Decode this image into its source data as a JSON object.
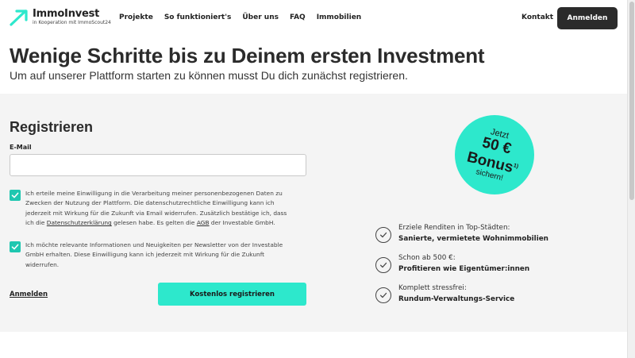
{
  "header": {
    "logo_name": "ImmoInvest",
    "logo_sub": "in Kooperation mit ImmoScout24",
    "nav": [
      "Projekte",
      "So funktioniert's",
      "Über uns",
      "FAQ",
      "Immobilien"
    ],
    "kontakt": "Kontakt",
    "anmelden": "Anmelden"
  },
  "hero": {
    "title": "Wenige Schritte bis zu Deinem ersten Investment",
    "subtitle": "Um auf unserer Plattform starten zu können musst Du dich zunächst registrieren."
  },
  "form": {
    "title": "Registrieren",
    "email_label": "E-Mail",
    "email_value": "",
    "email_placeholder": "",
    "consent1_a": "Ich erteile meine Einwilligung in die Verarbeitung meiner personenbezogenen Daten zu Zwecken der Nutzung der Plattform. Die datenschutzrechtliche Einwilligung kann ich jederzeit mit Wirkung für die Zukunft via Email widerrufen. Zusätzlich bestätige ich, dass ich die ",
    "consent1_link1": "Datenschutzerklärung",
    "consent1_b": " gelesen habe. Es gelten die ",
    "consent1_link2": "AGB",
    "consent1_c": " der Investable GmbH.",
    "consent2": "Ich möchte relevante Informationen und Neuigkeiten per Newsletter von der Investable GmbH erhalten. Diese Einwilligung kann ich jederzeit mit Wirkung für die Zukunft widerrufen.",
    "login_link": "Anmelden",
    "register_button": "Kostenlos registrieren"
  },
  "bonus": {
    "jetzt": "Jetzt",
    "amount": "50 €",
    "word": "Bonus",
    "sup": "1)",
    "sichern": "sichern!"
  },
  "benefits": [
    {
      "line1": "Erziele Renditen in Top-Städten:",
      "line2": "Sanierte, vermietete Wohnimmobilien"
    },
    {
      "line1": "Schon ab 500 €:",
      "line2": "Profitieren wie Eigentümer:innen"
    },
    {
      "line1": "Komplett stressfrei:",
      "line2": "Rundum-Verwaltungs-Service"
    }
  ],
  "colors": {
    "accent": "#2de8cc",
    "checkbox": "#1fc7b0",
    "dark_button": "#2b2b2b",
    "panel": "#f4f4f4"
  }
}
